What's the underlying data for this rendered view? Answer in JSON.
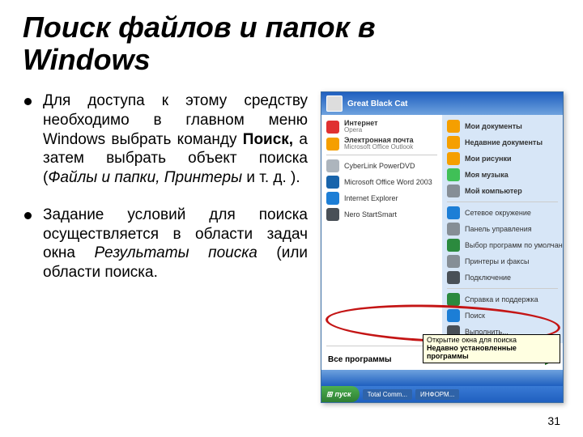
{
  "title_line1": "Поиск файлов и папок в",
  "title_line2": "Windows",
  "bullets": {
    "b1_pre": "Для доступа к этому средству необходимо в главном меню Windows выбрать команду ",
    "b1_bold": "Поиск,",
    "b1_mid": " а затем выбрать объект поиска (",
    "b1_ital": "Файлы и папки, Принтеры",
    "b1_post": " и т. д. ).",
    "b2_pre": "Задание условий для поиска осуществляется в области задач окна ",
    "b2_ital": "Результаты поиска",
    "b2_post": " (или области поиска."
  },
  "start": {
    "user": "Great Black Cat",
    "left": [
      {
        "label": "Интернет",
        "sub": "Opera",
        "color": "#e03131"
      },
      {
        "label": "Электронная почта",
        "sub": "Microsoft Office Outlook",
        "color": "#f59f00"
      },
      {
        "label": "CyberLink PowerDVD",
        "color": "#adb5bd"
      },
      {
        "label": "Microsoft Office Word 2003",
        "color": "#1864ab"
      },
      {
        "label": "Internet Explorer",
        "color": "#1c7ed6"
      },
      {
        "label": "Nero StartSmart",
        "color": "#495057"
      }
    ],
    "right": [
      {
        "label": "Мои документы",
        "color": "#f59f00"
      },
      {
        "label": "Недавние документы",
        "color": "#f59f00"
      },
      {
        "label": "Мои рисунки",
        "color": "#f59f00"
      },
      {
        "label": "Моя музыка",
        "color": "#40c057"
      },
      {
        "label": "Мой компьютер",
        "color": "#868e96"
      },
      {
        "label": "Сетевое окружение",
        "color": "#1c7ed6"
      },
      {
        "label": "Панель управления",
        "color": "#868e96"
      },
      {
        "label": "Выбор программ по умолчанию",
        "color": "#2b8a3e"
      },
      {
        "label": "Принтеры и факсы",
        "color": "#868e96"
      },
      {
        "label": "Подключение",
        "color": "#495057"
      },
      {
        "label": "Справка и поддержка",
        "color": "#2b8a3e"
      },
      {
        "label": "Поиск",
        "color": "#1c7ed6"
      },
      {
        "label": "Выполнить...",
        "color": "#495057"
      }
    ],
    "all": "Все программы",
    "tooltip_line1": "Открытие окна для поиска",
    "tooltip_line2": "Недавно установленные программы",
    "startbtn": "пуск",
    "tb1": "Total Comm...",
    "tb2": "ИНФОРМ..."
  },
  "pagenum": "31"
}
